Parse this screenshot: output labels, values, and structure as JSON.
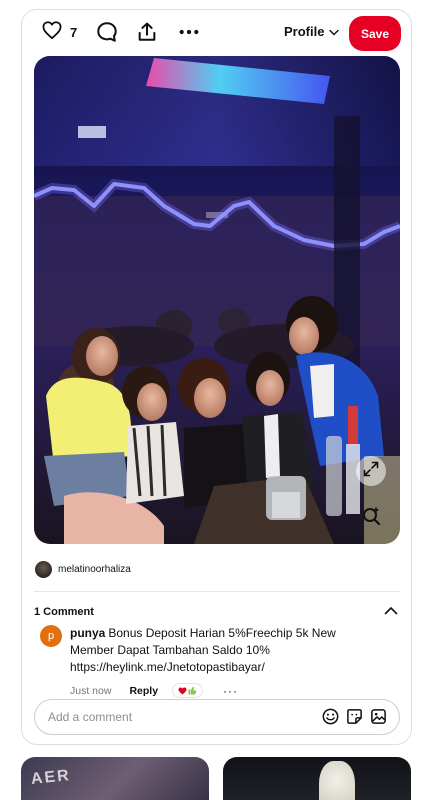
{
  "toolbar": {
    "like_count": "7",
    "profile_label": "Profile",
    "save_label": "Save"
  },
  "pin": {
    "author": "melatinoorhaliza"
  },
  "comments": {
    "title": "1 Comment",
    "items": [
      {
        "avatar_letter": "p",
        "user": "punya",
        "text": "Bonus Deposit Harian 5%Freechip 5k New Member Dapat Tambahan Saldo 10%",
        "link": "https://heylink.me/Jnetotopastibayar/",
        "time": "Just now",
        "reply_label": "Reply",
        "more_label": "···"
      }
    ]
  },
  "add_comment": {
    "placeholder": "Add a comment"
  },
  "feed": {
    "left_thumb_text": "AER"
  },
  "colors": {
    "save_red": "#e60023",
    "avatar_orange": "#e36f13",
    "neon_blue": "#7c7dff"
  },
  "icons": {
    "like": "heart-icon",
    "comment": "comment-bubble-icon",
    "share": "share-upload-icon",
    "more": "more-dots-icon",
    "profile_dropdown": "chevron-down-icon",
    "expand": "expand-icon",
    "visual_search": "lens-search-icon",
    "collapse": "chevron-up-icon",
    "emoji": "emoji-icon",
    "sticker": "sticker-icon",
    "image": "image-icon"
  }
}
